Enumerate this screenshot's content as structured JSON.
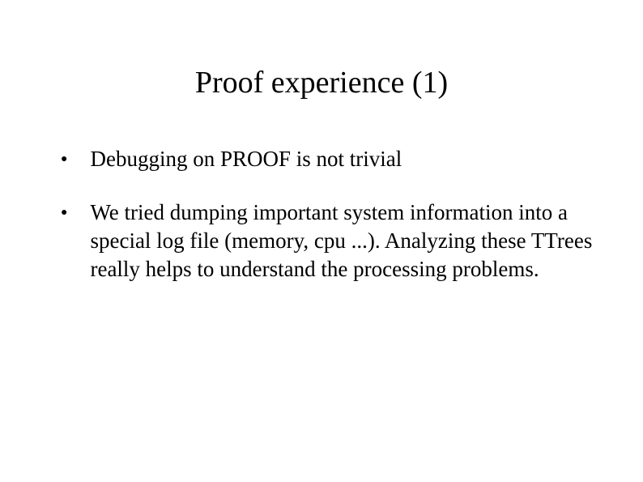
{
  "slide": {
    "title": "Proof experience (1)",
    "bullets": [
      "Debugging on PROOF is not trivial",
      "We tried dumping important system information into a special log file  (memory, cpu ...). Analyzing  these TTrees really helps to understand the processing problems."
    ]
  }
}
